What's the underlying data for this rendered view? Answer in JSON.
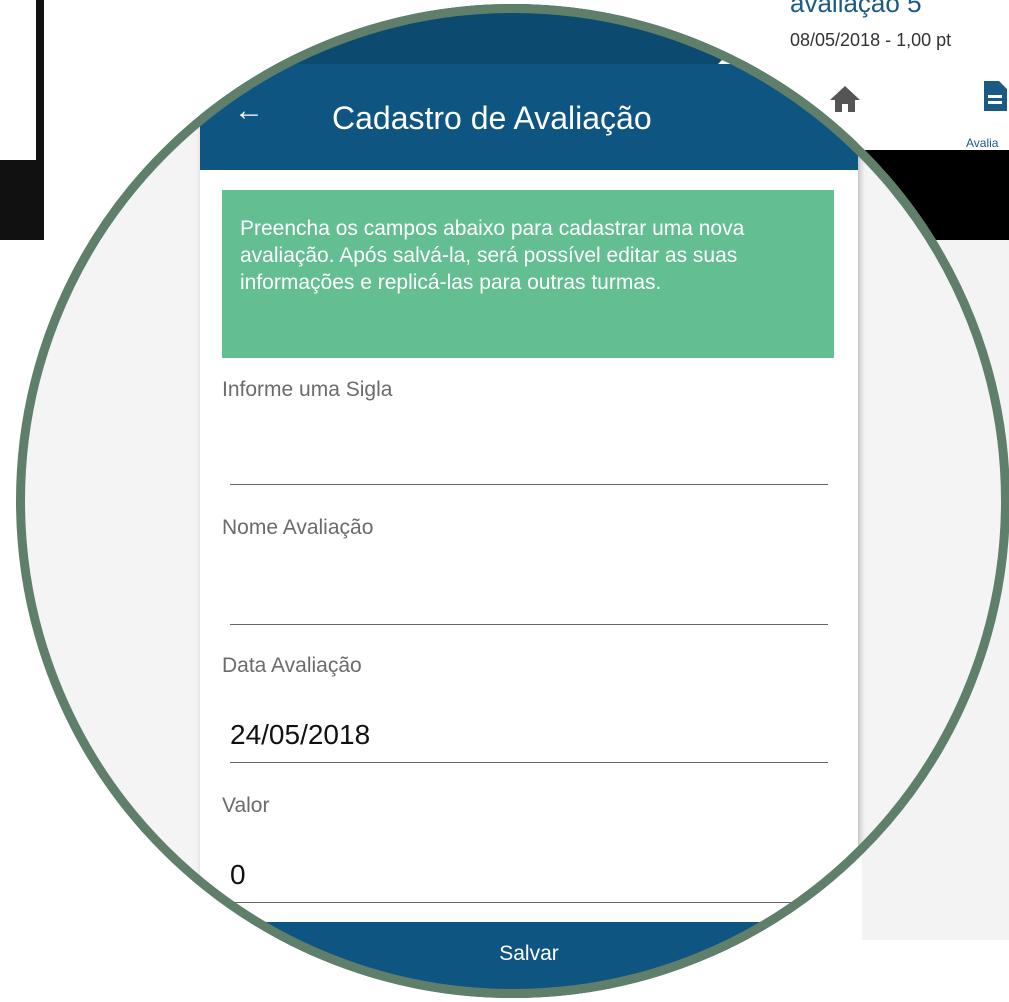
{
  "background": {
    "card_title": "avaliação 5",
    "card_subtitle": "08/05/2018 - 1,00 pt",
    "nav_label": "Avalia"
  },
  "header": {
    "title": "Cadastro de Avaliação"
  },
  "info_text": "Preencha os campos abaixo para cadastrar uma nova avaliação. Após salvá-la, será possível editar as suas informações e replicá-las para outras turmas.",
  "form": {
    "sigla_label": "Informe uma Sigla",
    "sigla_value": "",
    "nome_label": "Nome Avaliação",
    "nome_value": "",
    "data_label": "Data Avaliação",
    "data_value": "24/05/2018",
    "valor_label": "Valor",
    "valor_value": "0"
  },
  "actions": {
    "save_label": "Salvar"
  },
  "colors": {
    "primary": "#0e5582",
    "info": "#63bf91",
    "ring": "#5f7f6a"
  },
  "icons": {
    "back": "arrow-left-icon",
    "home": "home-icon",
    "document": "document-icon"
  }
}
